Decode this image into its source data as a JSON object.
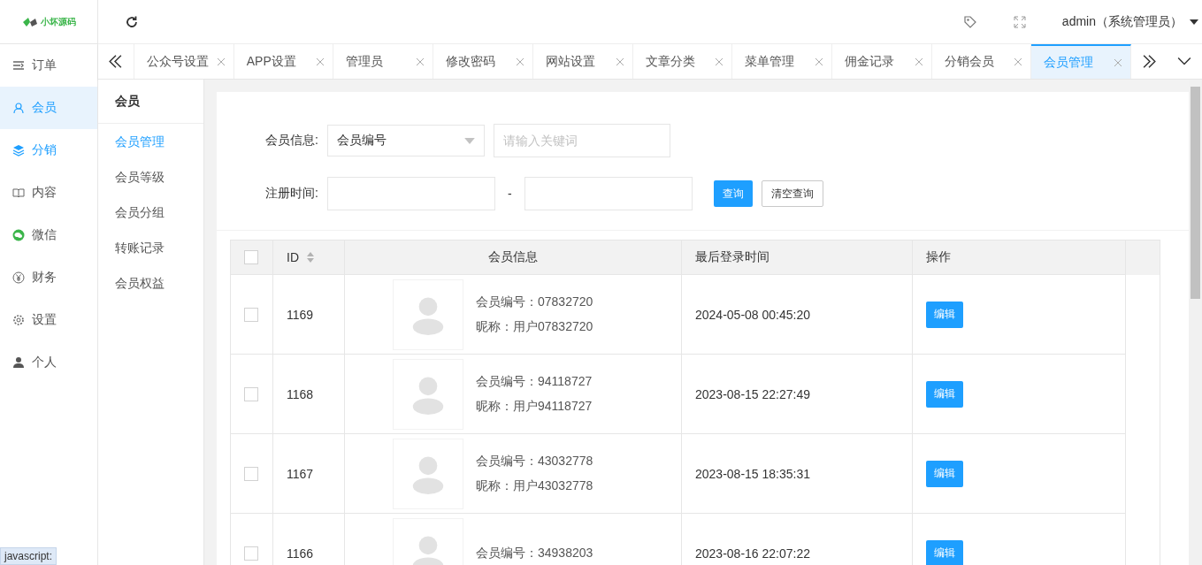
{
  "logo": {
    "text": "小坏源码"
  },
  "header": {
    "user": "admin（系统管理员）"
  },
  "sidebar": {
    "items": [
      {
        "label": "订单",
        "kind": "list",
        "selected": false,
        "hovered": false
      },
      {
        "label": "会员",
        "kind": "user",
        "selected": true,
        "hovered": false
      },
      {
        "label": "分销",
        "kind": "layers",
        "selected": false,
        "hovered": true
      },
      {
        "label": "内容",
        "kind": "book",
        "selected": false,
        "hovered": false
      },
      {
        "label": "微信",
        "kind": "wechat",
        "selected": false,
        "hovered": false
      },
      {
        "label": "财务",
        "kind": "yen",
        "selected": false,
        "hovered": false
      },
      {
        "label": "设置",
        "kind": "gear",
        "selected": false,
        "hovered": false
      },
      {
        "label": "个人",
        "kind": "person",
        "selected": false,
        "hovered": false
      }
    ]
  },
  "tabs": [
    {
      "label": "公众号设置",
      "selected": false
    },
    {
      "label": "APP设置",
      "selected": false
    },
    {
      "label": "管理员",
      "selected": false
    },
    {
      "label": "修改密码",
      "selected": false
    },
    {
      "label": "网站设置",
      "selected": false
    },
    {
      "label": "文章分类",
      "selected": false
    },
    {
      "label": "菜单管理",
      "selected": false
    },
    {
      "label": "佣金记录",
      "selected": false
    },
    {
      "label": "分销会员",
      "selected": false
    },
    {
      "label": "会员管理",
      "selected": true
    }
  ],
  "submenu": {
    "title": "会员",
    "items": [
      {
        "label": "会员管理",
        "selected": true
      },
      {
        "label": "会员等级",
        "selected": false
      },
      {
        "label": "会员分组",
        "selected": false
      },
      {
        "label": "转账记录",
        "selected": false
      },
      {
        "label": "会员权益",
        "selected": false
      }
    ]
  },
  "filters": {
    "info_label": "会员信息:",
    "info_select": "会员编号",
    "keyword_placeholder": "请输入关键词",
    "date_label": "注册时间:",
    "date_separator": "-",
    "search_button": "查询",
    "clear_button": "清空查询"
  },
  "table": {
    "columns": [
      "ID",
      "会员信息",
      "最后登录时间",
      "操作"
    ],
    "select_all_checked": false,
    "rows": [
      {
        "checked": false,
        "id": "1169",
        "member_no": "会员编号：07832720",
        "nickname": "昵称：用户07832720",
        "last_login": "2024-05-08 00:45:20",
        "action": "编辑"
      },
      {
        "checked": false,
        "id": "1168",
        "member_no": "会员编号：94118727",
        "nickname": "昵称：用户94118727",
        "last_login": "2023-08-15 22:27:49",
        "action": "编辑"
      },
      {
        "checked": false,
        "id": "1167",
        "member_no": "会员编号：43032778",
        "nickname": "昵称：用户43032778",
        "last_login": "2023-08-15 18:35:31",
        "action": "编辑"
      },
      {
        "checked": false,
        "id": "1166",
        "member_no": "会员编号：34938203",
        "last_login": "2023-08-16 22:07:22",
        "action": "编辑"
      }
    ]
  },
  "status_bar": {
    "text": "javascript:"
  }
}
